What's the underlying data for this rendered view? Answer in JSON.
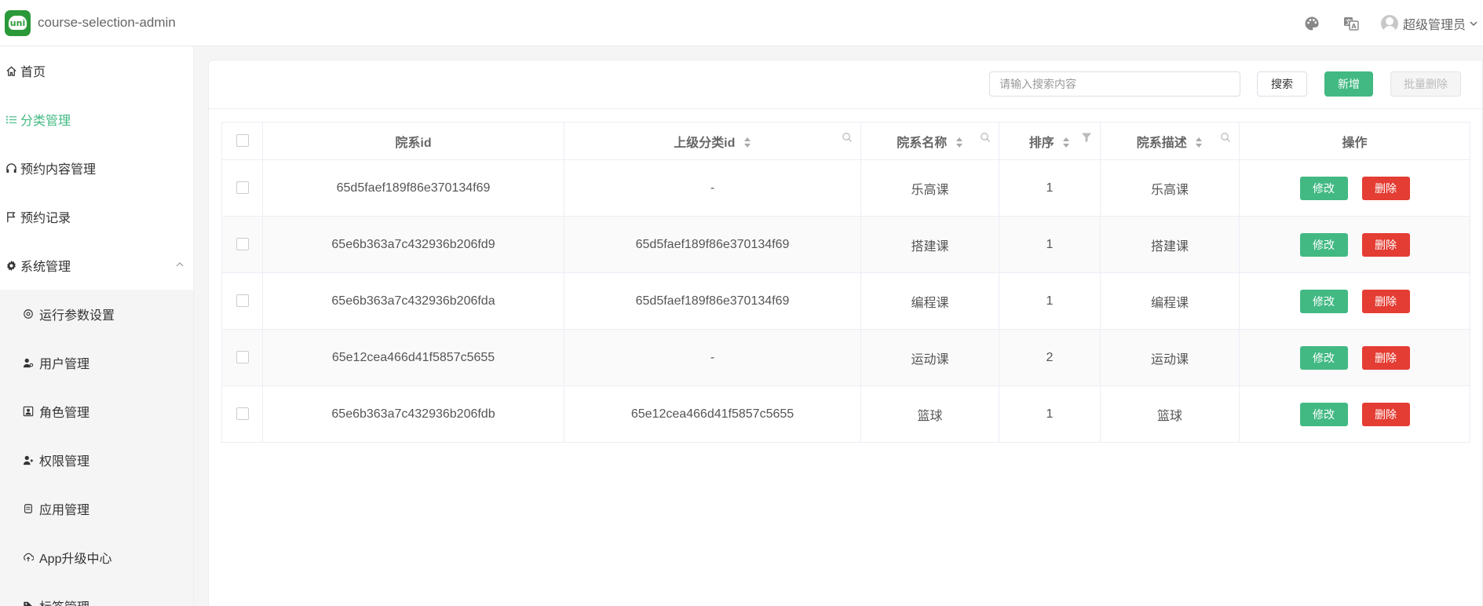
{
  "app": {
    "logo_text": "uni",
    "title": "course-selection-admin"
  },
  "header": {
    "icons": [
      "palette-icon",
      "translate-icon"
    ],
    "user_name": "超级管理员"
  },
  "sidebar": {
    "items": [
      {
        "label": "首页",
        "icon": "home-icon",
        "active": false
      },
      {
        "label": "分类管理",
        "icon": "list-icon",
        "active": true
      },
      {
        "label": "预约内容管理",
        "icon": "headphones-icon",
        "active": false
      },
      {
        "label": "预约记录",
        "icon": "flag-icon",
        "active": false
      },
      {
        "label": "系统管理",
        "icon": "gear-icon",
        "active": false,
        "expanded": true
      }
    ],
    "sub_items": [
      {
        "label": "运行参数设置",
        "icon": "settings-icon"
      },
      {
        "label": "用户管理",
        "icon": "user-icon"
      },
      {
        "label": "角色管理",
        "icon": "role-icon"
      },
      {
        "label": "权限管理",
        "icon": "permission-icon"
      },
      {
        "label": "应用管理",
        "icon": "app-icon"
      },
      {
        "label": "App升级中心",
        "icon": "upgrade-icon"
      },
      {
        "label": "标签管理",
        "icon": "tag-icon"
      }
    ]
  },
  "toolbar": {
    "search_placeholder": "请输入搜索内容",
    "search_label": "搜索",
    "add_label": "新增",
    "batch_delete_label": "批量删除"
  },
  "table": {
    "columns": [
      {
        "label": "院系id",
        "sortable": false,
        "search": false,
        "filter": false
      },
      {
        "label": "上级分类id",
        "sortable": true,
        "search": true,
        "filter": false
      },
      {
        "label": "院系名称",
        "sortable": true,
        "search": true,
        "filter": false
      },
      {
        "label": "排序",
        "sortable": true,
        "search": false,
        "filter": true
      },
      {
        "label": "院系描述",
        "sortable": true,
        "search": true,
        "filter": false
      },
      {
        "label": "操作",
        "sortable": false,
        "search": false,
        "filter": false
      }
    ],
    "edit_label": "修改",
    "delete_label": "删除",
    "rows": [
      {
        "id": "65d5faef189f86e370134f69",
        "parent_id": "-",
        "name": "乐高课",
        "sort": "1",
        "desc": "乐高课"
      },
      {
        "id": "65e6b363a7c432936b206fd9",
        "parent_id": "65d5faef189f86e370134f69",
        "name": "搭建课",
        "sort": "1",
        "desc": "搭建课"
      },
      {
        "id": "65e6b363a7c432936b206fda",
        "parent_id": "65d5faef189f86e370134f69",
        "name": "编程课",
        "sort": "1",
        "desc": "编程课"
      },
      {
        "id": "65e12cea466d41f5857c5655",
        "parent_id": "-",
        "name": "运动课",
        "sort": "2",
        "desc": "运动课"
      },
      {
        "id": "65e6b363a7c432936b206fdb",
        "parent_id": "65e12cea466d41f5857c5655",
        "name": "篮球",
        "sort": "1",
        "desc": "篮球"
      }
    ]
  },
  "colors": {
    "brand": "#2b9939",
    "primary": "#42b983",
    "danger": "#e43d33"
  }
}
